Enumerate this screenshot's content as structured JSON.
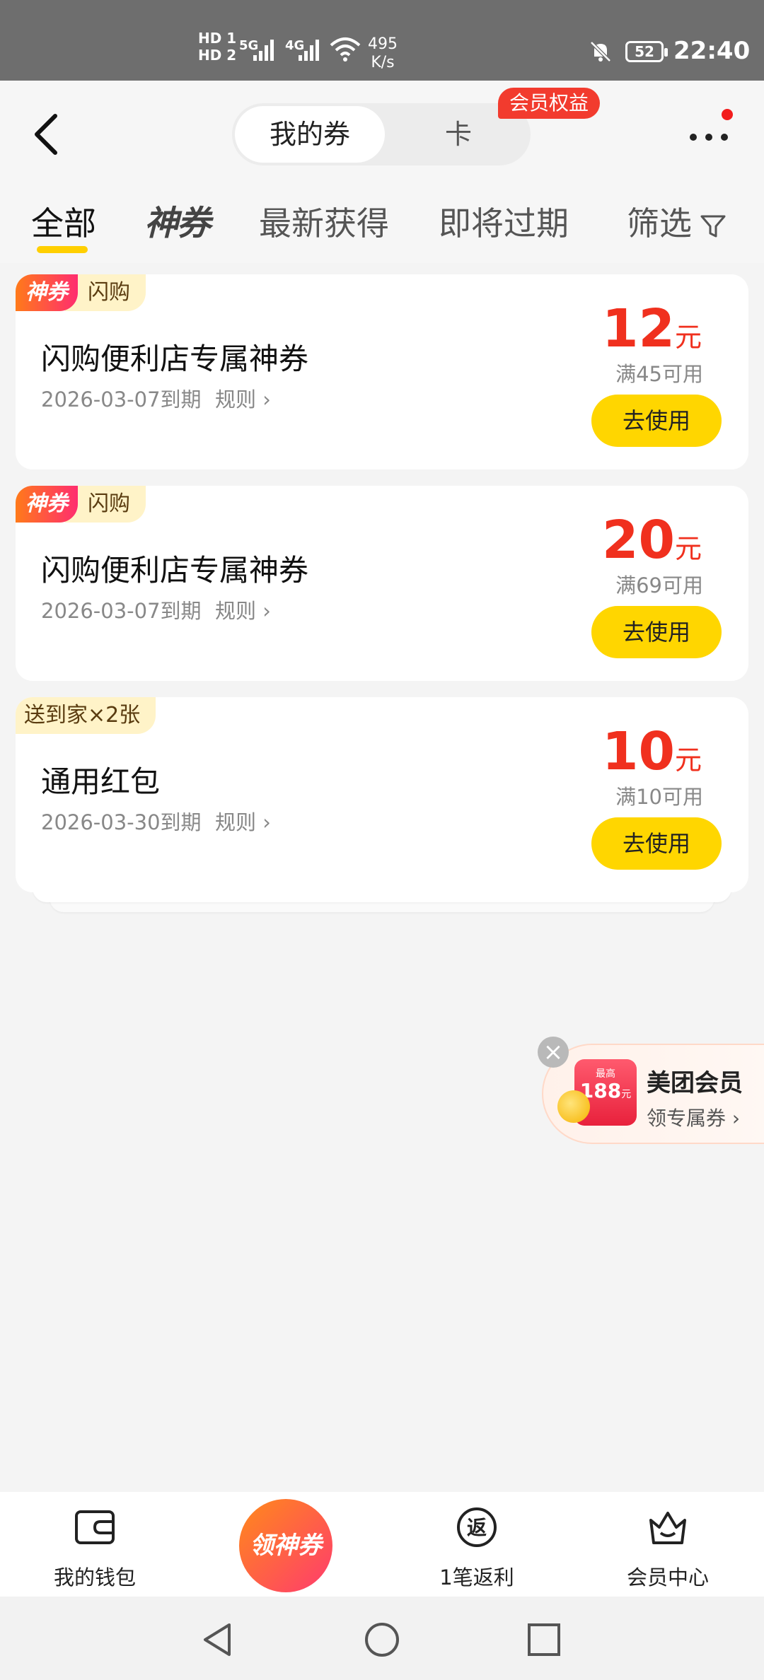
{
  "status_bar": {
    "hd1": "HD 1",
    "hd2": "HD 2",
    "net1": "5G",
    "net2": "4G",
    "speed_value": "495",
    "speed_unit": "K/s",
    "battery": "52",
    "time": "22:40"
  },
  "header": {
    "segment_active": "我的券",
    "segment_other": "卡",
    "vip_badge": "会员权益"
  },
  "tabs": [
    {
      "label": "全部"
    },
    {
      "label": "神券"
    },
    {
      "label": "最新获得"
    },
    {
      "label": "即将过期"
    },
    {
      "label": "筛选"
    }
  ],
  "coupons": [
    {
      "tag_primary": "神券",
      "tag_secondary": "闪购",
      "title": "闪购便利店专属神券",
      "expiry": "2026-03-07到期",
      "rule": "规则",
      "amount": "12",
      "unit": "元",
      "condition": "满45可用",
      "button": "去使用"
    },
    {
      "tag_primary": "神券",
      "tag_secondary": "闪购",
      "title": "闪购便利店专属神券",
      "expiry": "2026-03-07到期",
      "rule": "规则",
      "amount": "20",
      "unit": "元",
      "condition": "满69可用",
      "button": "去使用"
    },
    {
      "tag_delivery": "送到家×2张",
      "title": "通用红包",
      "expiry": "2026-03-30到期",
      "rule": "规则",
      "amount": "10",
      "unit": "元",
      "condition": "满10可用",
      "button": "去使用"
    }
  ],
  "vip_float": {
    "card_label": "最高",
    "card_amount": "188",
    "card_unit": "元",
    "title": "美团会员",
    "subtitle": "领专属券"
  },
  "bottom_nav": {
    "wallet": "我的钱包",
    "center": "领神券",
    "rebate_icon": "返",
    "rebate": "1笔返利",
    "member": "会员中心"
  },
  "colors": {
    "accent_yellow": "#ffd600",
    "price_red": "#f0301e",
    "badge_red": "#f23b2e"
  }
}
